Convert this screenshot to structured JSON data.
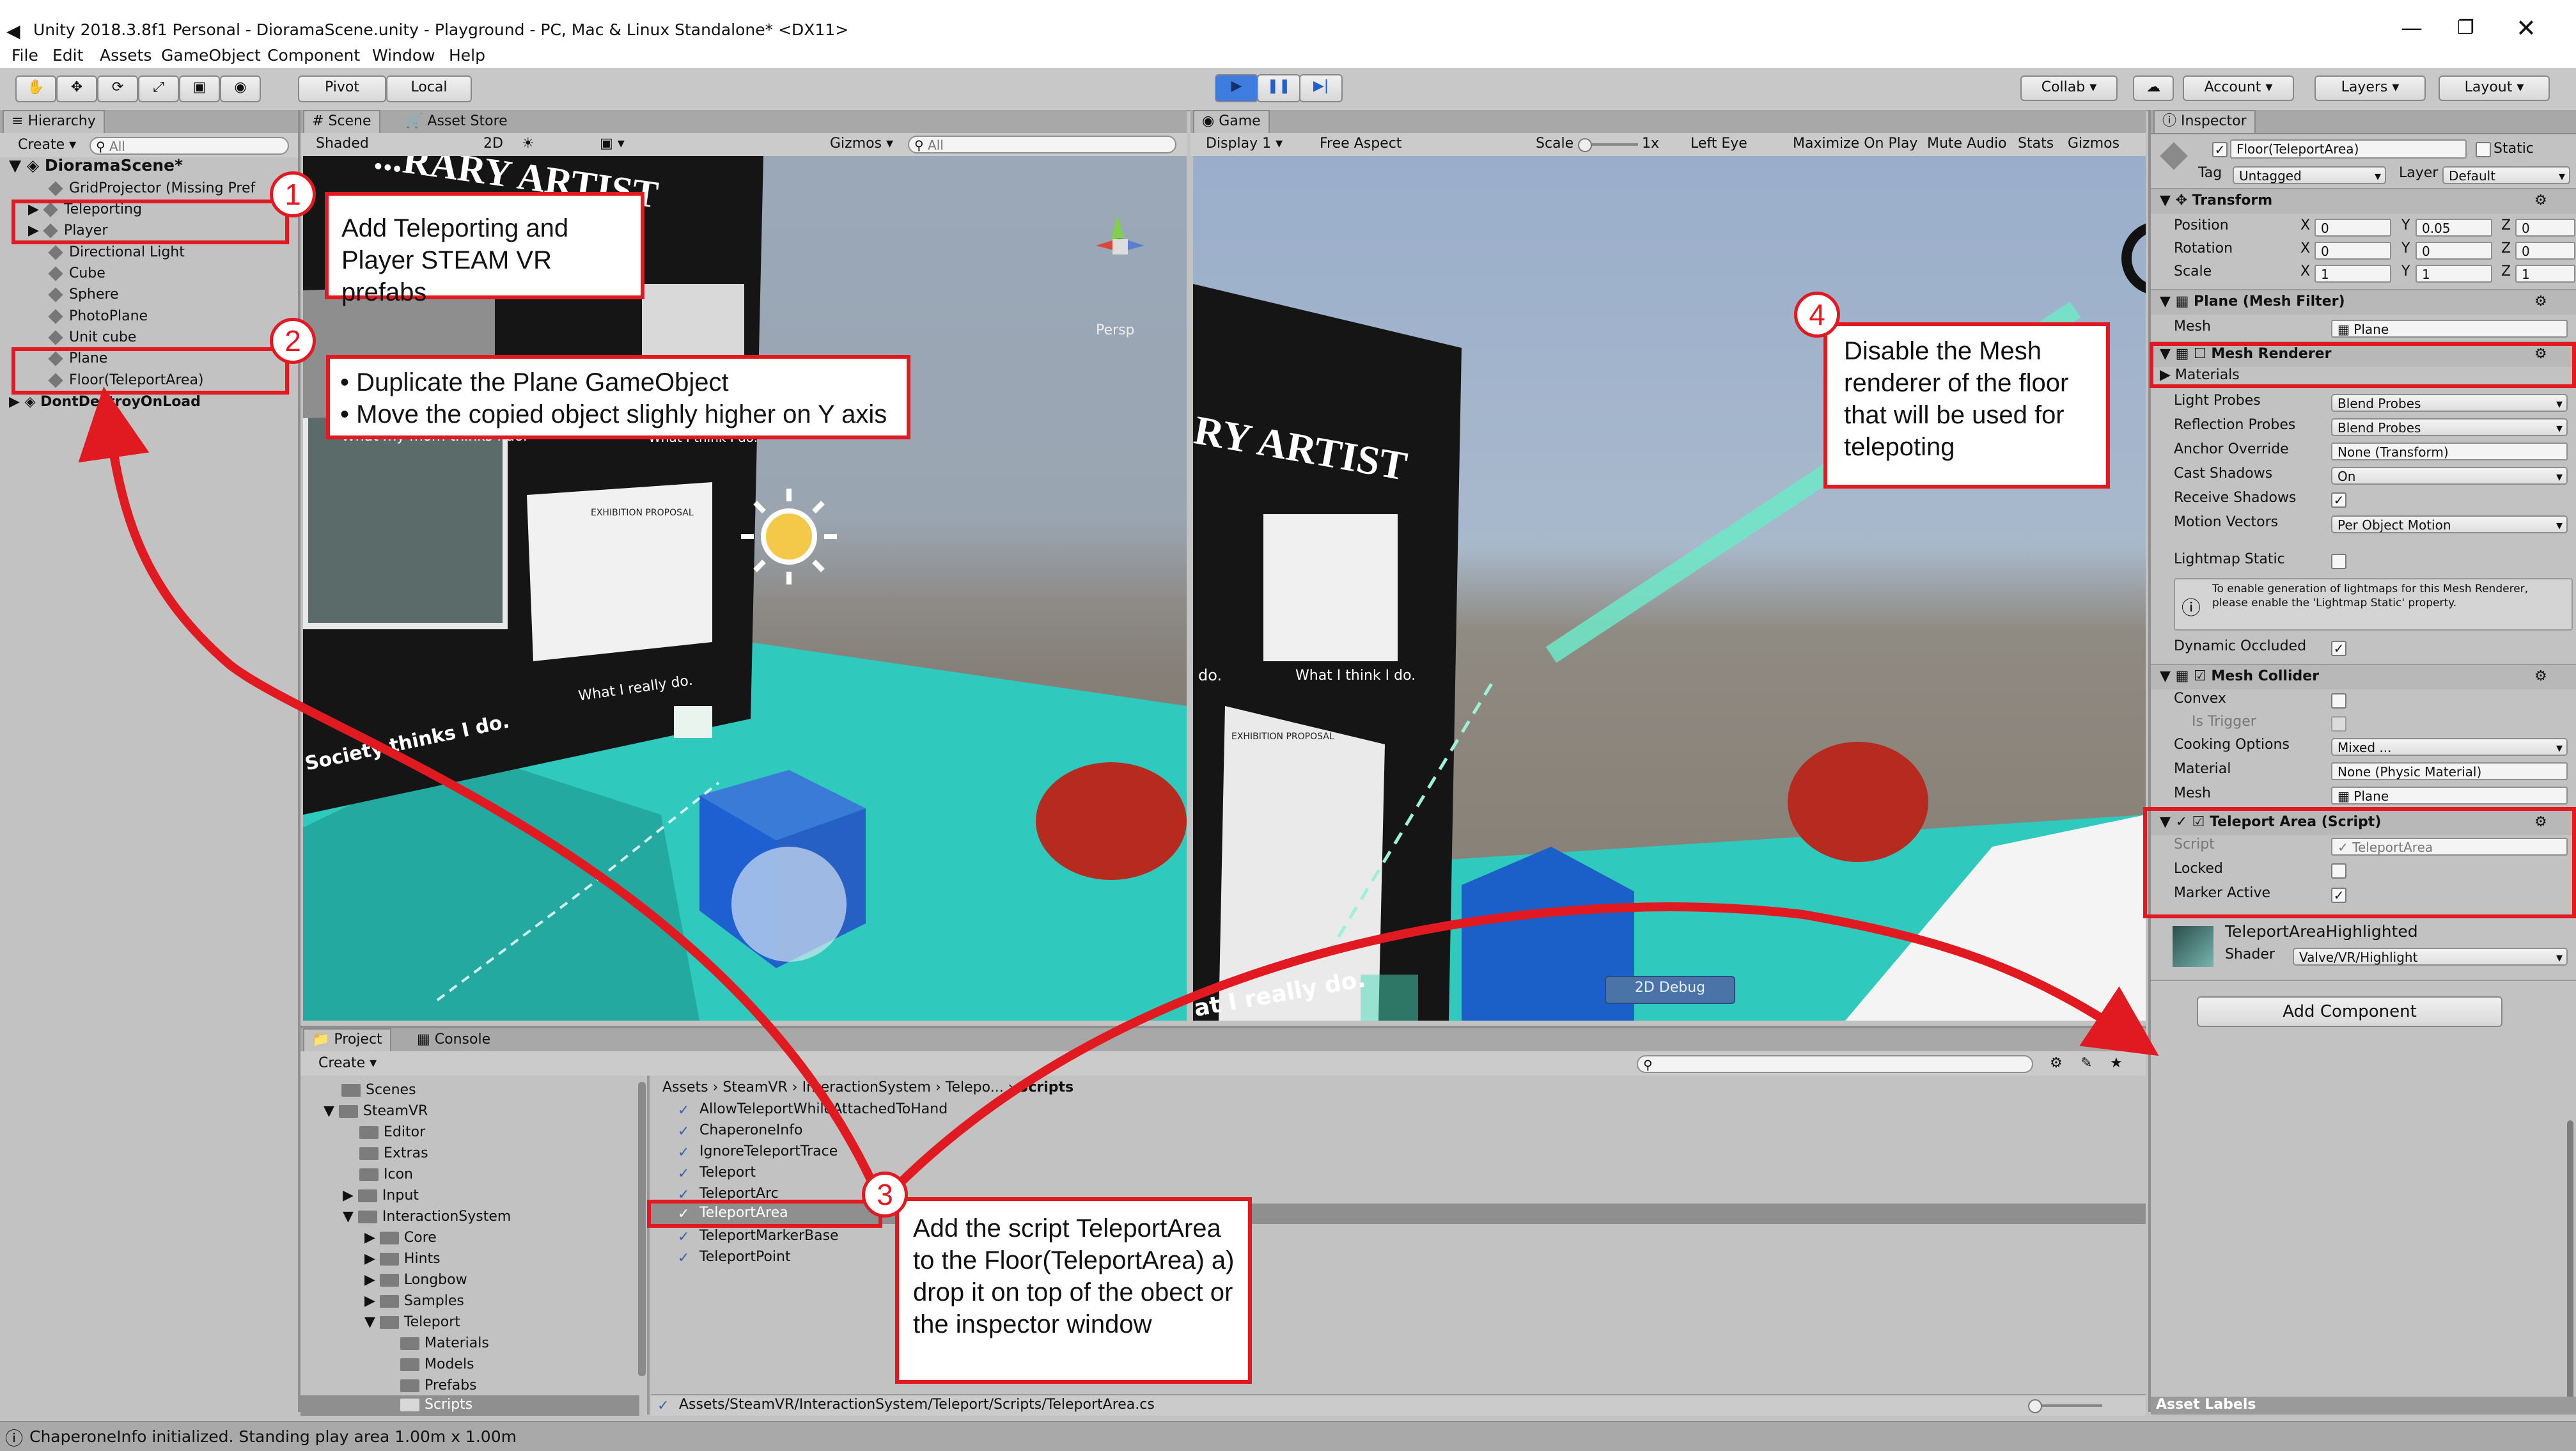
{
  "window": {
    "title": "Unity 2018.3.8f1 Personal - DioramaScene.unity - Playground - PC, Mac & Linux Standalone* <DX11>"
  },
  "menu": [
    "File",
    "Edit",
    "Assets",
    "GameObject",
    "Component",
    "Window",
    "Help"
  ],
  "toolbar": {
    "pivot": "Pivot",
    "local": "Local",
    "collab": "Collab",
    "account": "Account",
    "layers": "Layers",
    "layout": "Layout"
  },
  "hierarchy": {
    "tab": "Hierarchy",
    "create": "Create",
    "search": "All",
    "scene": "DioramaScene*",
    "items": [
      "GridProjector (Missing Pref",
      "Teleporting",
      "Player",
      "Directional Light",
      "Cube",
      "Sphere",
      "PhotoPlane",
      "Unit cube",
      "Plane",
      "Floor(TeleportArea)"
    ],
    "dontdestroy": "DontDestroyOnLoad"
  },
  "scene": {
    "tab": "Scene",
    "tab2": "Asset Store",
    "shaded": "Shaded",
    "mode2d": "2D",
    "gizmos": "Gizmos",
    "search": "All",
    "persp": "Persp"
  },
  "game": {
    "tab": "Game",
    "display": "Display 1",
    "aspect": "Free Aspect",
    "scale": "Scale",
    "scale_val": "1x",
    "eye": "Left Eye",
    "maximize": "Maximize On Play",
    "mute": "Mute Audio",
    "stats": "Stats",
    "gizmos": "Gizmos",
    "debug": "2D Debug"
  },
  "scene_art": {
    "sign_top": "...RARY ARTIST",
    "sign_game": "RY ARTIST",
    "mom": "What my mom thinks I do.",
    "think": "What I think I do.",
    "really": "What I really do.",
    "society": "Society thinks I do.",
    "proposal": "EXHIBITION PROPOSAL",
    "do_txt": "do.",
    "really2": "at I really do."
  },
  "inspector": {
    "tab": "Inspector",
    "object": "Floor(TeleportArea)",
    "static": "Static",
    "tag_label": "Tag",
    "tag": "Untagged",
    "layer_label": "Layer",
    "layer": "Default",
    "transform": {
      "title": "Transform",
      "position": "Position",
      "rotation": "Rotation",
      "scale": "Scale",
      "pos": [
        "0",
        "0.05",
        "0"
      ],
      "rot": [
        "0",
        "0",
        "0"
      ],
      "scl": [
        "1",
        "1",
        "1"
      ]
    },
    "meshfilter": {
      "title": "Plane (Mesh Filter)",
      "mesh_label": "Mesh",
      "mesh": "Plane"
    },
    "renderer": {
      "title": "Mesh Renderer",
      "materials": "Materials",
      "light_probes": "Light Probes",
      "light_probes_v": "Blend Probes",
      "refl": "Reflection Probes",
      "refl_v": "Blend Probes",
      "anchor": "Anchor Override",
      "anchor_v": "None (Transform)",
      "cast": "Cast Shadows",
      "cast_v": "On",
      "receive": "Receive Shadows",
      "motion": "Motion Vectors",
      "motion_v": "Per Object Motion",
      "lightmap": "Lightmap Static",
      "info": "To enable generation of lightmaps for this Mesh Renderer, please enable the 'Lightmap Static' property.",
      "occluded": "Dynamic Occluded"
    },
    "collider": {
      "title": "Mesh Collider",
      "convex": "Convex",
      "trigger": "Is Trigger",
      "cooking": "Cooking Options",
      "cooking_v": "Mixed ...",
      "material": "Material",
      "material_v": "None (Physic Material)",
      "mesh": "Mesh",
      "mesh_v": "Plane"
    },
    "teleport": {
      "title": "Teleport Area (Script)",
      "script": "Script",
      "script_v": "TeleportArea",
      "locked": "Locked",
      "marker": "Marker Active"
    },
    "highlight": {
      "title": "TeleportAreaHighlighted",
      "shader": "Shader",
      "shader_v": "Valve/VR/Highlight"
    },
    "add_component": "Add Component",
    "asset_labels": "Asset Labels"
  },
  "project": {
    "tab": "Project",
    "tab2": "Console",
    "create": "Create",
    "tree": [
      "Scenes",
      "SteamVR",
      "Editor",
      "Extras",
      "Icon",
      "Input",
      "InteractionSystem",
      "Core",
      "Hints",
      "Longbow",
      "Samples",
      "Teleport",
      "Materials",
      "Models",
      "Prefabs",
      "Scripts"
    ],
    "breadcrumb": [
      "Assets",
      "SteamVR",
      "InteractionSystem",
      "Telepo...",
      "Scripts"
    ],
    "files": [
      "AllowTeleportWhileAttachedToHand",
      "ChaperoneInfo",
      "IgnoreTeleportTrace",
      "Teleport",
      "TeleportArc",
      "TeleportArea",
      "TeleportMarkerBase",
      "TeleportPoint"
    ],
    "path": "Assets/SteamVR/InteractionSystem/Teleport/Scripts/TeleportArea.cs"
  },
  "status": "ChaperoneInfo initialized. Standing play area 1.00m x 1.00m",
  "callouts": {
    "c1": "Add Teleporting and Player STEAM VR prefabs",
    "c2a": "• Duplicate the Plane GameObject",
    "c2b": "• Move the copied object slighly higher on Y axis",
    "c3": "Add the script TeleportArea to the Floor(TeleportArea) a) drop it on top of the obect or the inspector window",
    "c4": "Disable the Mesh renderer of the floor that will be used for telepoting",
    "n1": "1",
    "n2": "2",
    "n3": "3",
    "n4": "4"
  },
  "colors": {
    "annotation_red": "#e11a22",
    "floor_teal": "#2fc9bd",
    "sky": "#a9b9cc"
  }
}
